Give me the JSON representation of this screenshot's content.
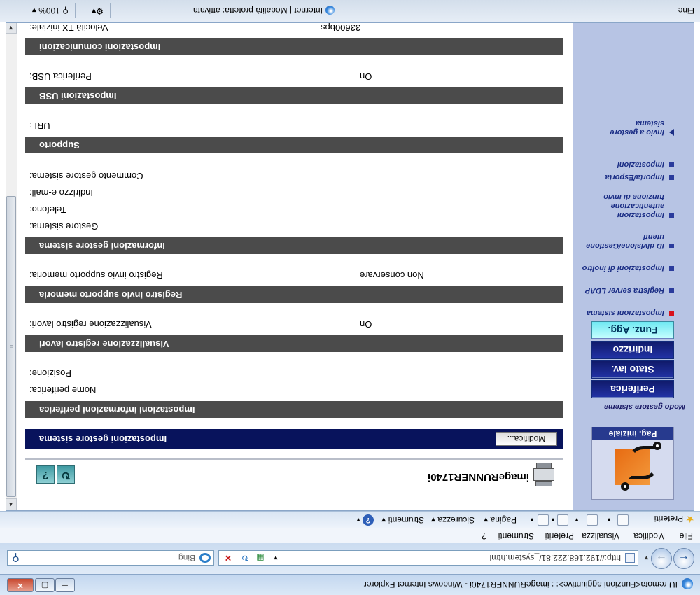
{
  "window": {
    "title": "IU remota<Funzioni aggiuntive>: : imageRUNNER1740i - Windows Internet Explorer",
    "min": "─",
    "max": "▢",
    "close": "✕"
  },
  "addressbar": {
    "url": "http://192.168.222.81/_system.html",
    "search_placeholder": "Bing",
    "back_icon": "back-arrow-icon",
    "forward_icon": "forward-arrow-icon"
  },
  "menu": [
    "File",
    "Modifica",
    "Visualizza",
    "Preferiti",
    "Strumenti",
    "?"
  ],
  "commandbar": {
    "favorites": "Preferiti",
    "page": "Pagina",
    "security": "Sicurezza",
    "tools": "Strumenti",
    "help": "?"
  },
  "leftpanel": {
    "home_label": "Pag. iniziale",
    "mode_title": "Modo gestore sistema",
    "nav_buttons": [
      "Periferica",
      "Stato lav.",
      "Indirizzo",
      "Funz. Agg."
    ],
    "links": [
      {
        "label": "Impostazioni sistema",
        "active": true
      },
      {
        "label": "Registra server LDAP",
        "active": false
      },
      {
        "label": "Impostazioni di inoltro",
        "active": false
      },
      {
        "label": "ID divisione/Gestione utenti",
        "active": false
      },
      {
        "label": "Impostazioni autenticazione funzione di invio",
        "active": false
      },
      {
        "label": "Importa/Esporta",
        "active": false
      },
      {
        "label": "Impostazioni",
        "active": false
      },
      {
        "label": "Invio a gestore sistema",
        "active": false
      }
    ]
  },
  "main": {
    "device_name": "imageRUNNER1740i",
    "header": {
      "title": "Impostazioni gestore sistema",
      "edit": "Modifica..."
    },
    "sections": {
      "device_info": {
        "title": "Impostazioni informazioni periferica",
        "fields": [
          {
            "label": "Nome periferica:",
            "value": ""
          },
          {
            "label": "Posizione:",
            "value": ""
          }
        ]
      },
      "job_log": {
        "title": "Visualizzazione registro lavori",
        "fields": [
          {
            "label": "Visualizzazione registro lavori:",
            "value": "On"
          }
        ]
      },
      "memory_log": {
        "title": "Registro invio supporto memoria",
        "fields": [
          {
            "label": "Registro invio supporto memoria:",
            "value": "Non conservare"
          }
        ]
      },
      "admin_info": {
        "title": "Informazioni gestore sistema",
        "fields": [
          {
            "label": "Gestore sistema:",
            "value": ""
          },
          {
            "label": "Telefono:",
            "value": ""
          },
          {
            "label": "Indirizzo e-mail:",
            "value": ""
          },
          {
            "label": "Commento gestore sistema:",
            "value": ""
          }
        ]
      },
      "support": {
        "title": "Supporto",
        "fields": [
          {
            "label": "URL:",
            "value": ""
          }
        ]
      },
      "usb": {
        "title": "Impostazioni USB",
        "fields": [
          {
            "label": "Periferica USB:",
            "value": "On"
          }
        ]
      },
      "comm": {
        "title": "Impostazioni comunicazioni",
        "fields": [
          {
            "label": "Velocità TX iniziale:",
            "value": "33600bps"
          }
        ]
      }
    }
  },
  "statusbar": {
    "left": "Fine",
    "zone": "Internet | Modalità protetta: attivata",
    "zoom": "100%"
  }
}
